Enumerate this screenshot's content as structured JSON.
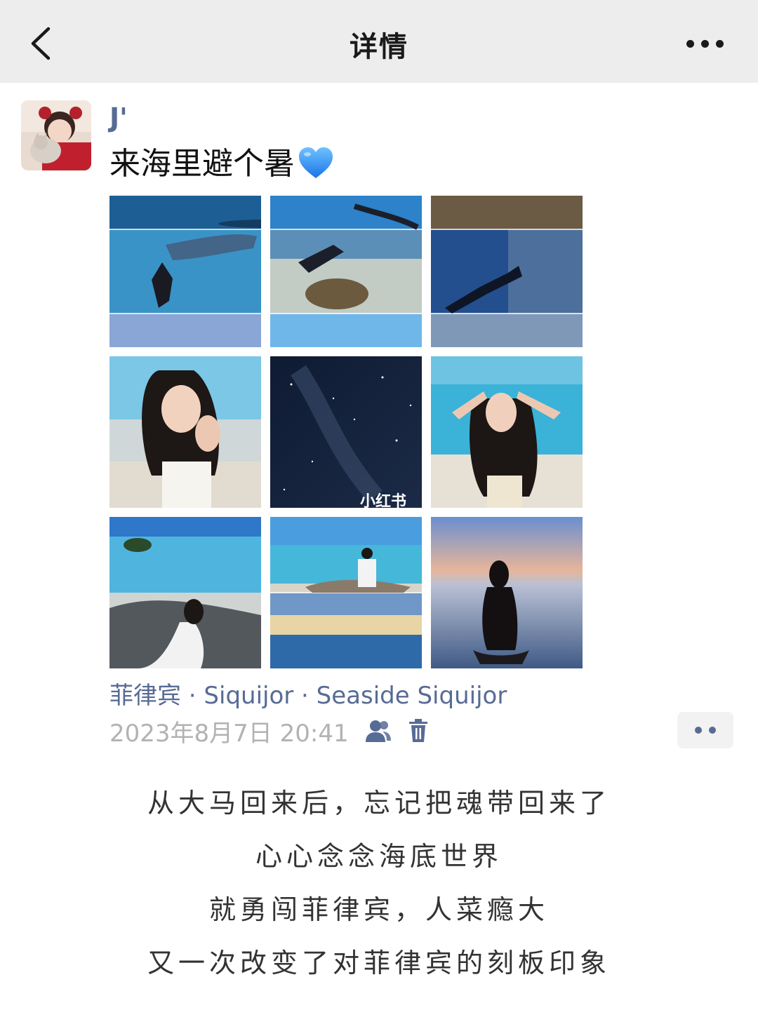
{
  "header": {
    "title": "详情",
    "back_icon": "chevron-left-icon",
    "more_icon": "more-horizontal-icon"
  },
  "post": {
    "username": "J'",
    "text": "来海里避个暑",
    "emoji": "blue-heart-icon",
    "photos": [
      {
        "label": "underwater-whale-shark-diver"
      },
      {
        "label": "underwater-turtle-diver"
      },
      {
        "label": "underwater-diver-sardines"
      },
      {
        "label": "beach-portrait-girl-hands-face"
      },
      {
        "label": "night-sky-milky-way",
        "watermark": "小红书"
      },
      {
        "label": "beach-portrait-girl-hands-head"
      },
      {
        "label": "beach-girl-white-dress-sitting"
      },
      {
        "label": "beach-driftwood-sunset"
      },
      {
        "label": "sunset-girl-in-sea"
      }
    ],
    "location": "菲律宾 · Siquijor · Seaside Siquijor",
    "timestamp": "2023年8月7日 20:41",
    "friends_icon": "friends-visibility-icon",
    "delete_icon": "trash-icon",
    "action_icon": "comment-like-more-icon"
  },
  "caption": {
    "lines": [
      "从大马回来后，忘记把魂带回来了",
      "心心念念海底世界",
      "就勇闯菲律宾，人菜瘾大",
      "又一次改变了对菲律宾的刻板印象"
    ]
  },
  "colors": {
    "link": "#576b95",
    "nav_bg": "#ededed",
    "meta_gray": "#b2b2b2"
  }
}
